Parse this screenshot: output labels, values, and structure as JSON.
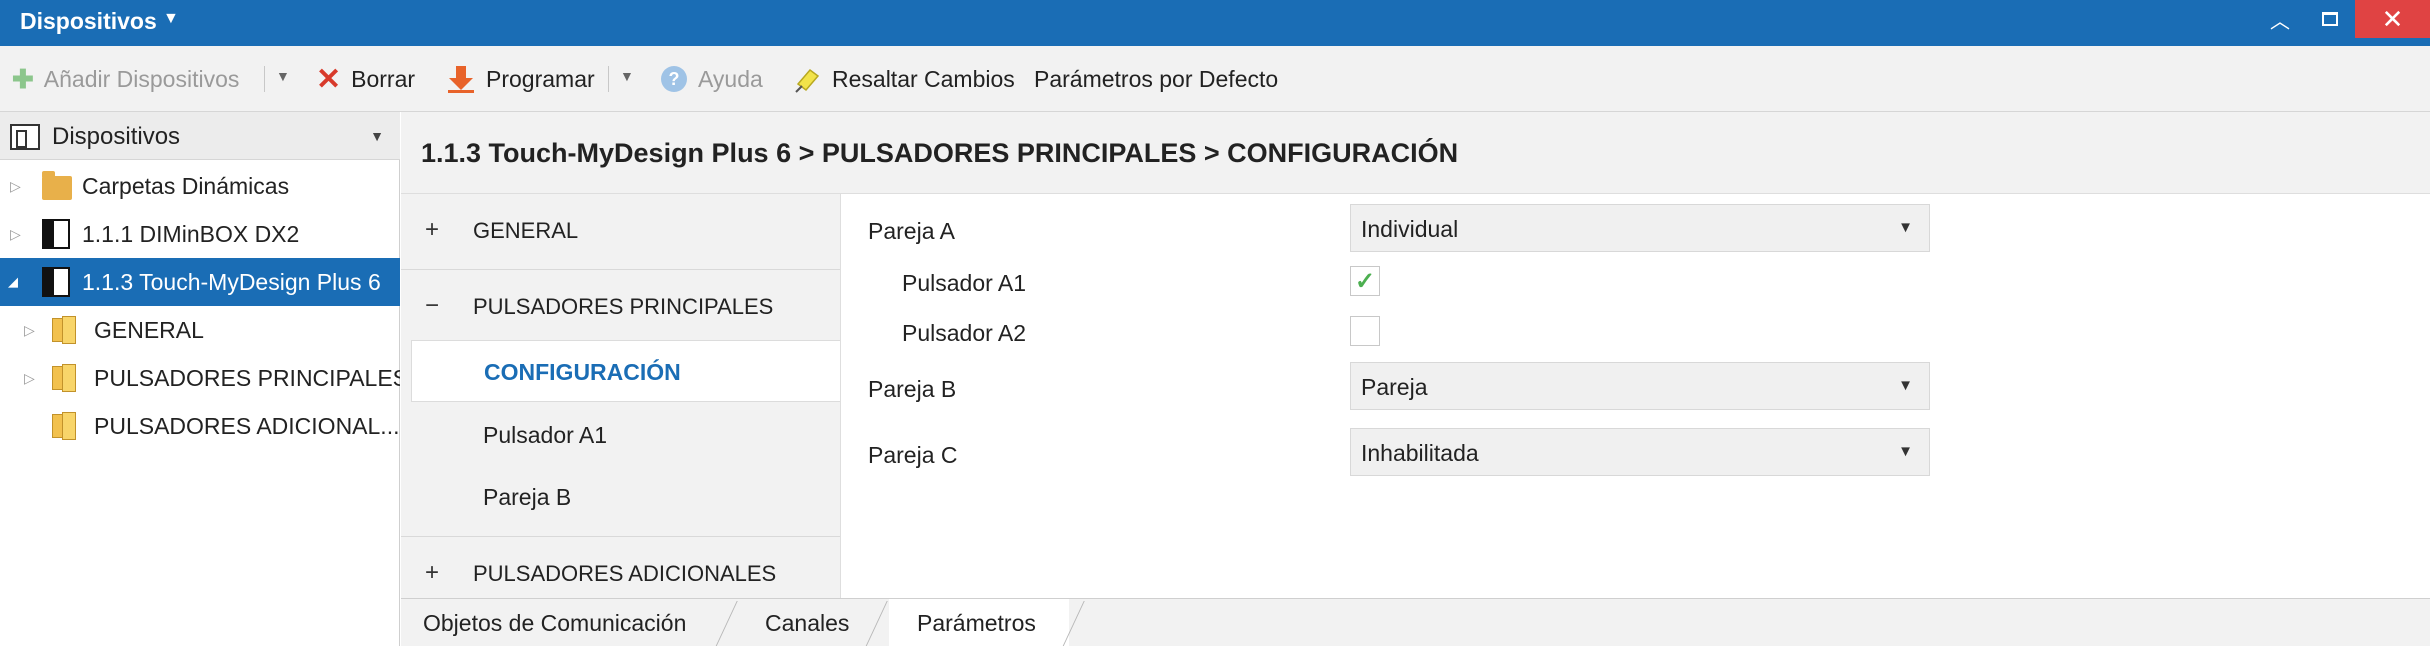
{
  "window": {
    "title": "Dispositivos"
  },
  "toolbar": {
    "add_devices": "Añadir Dispositivos",
    "delete": "Borrar",
    "program": "Programar",
    "help": "Ayuda",
    "highlight_changes": "Resaltar Cambios",
    "default_params": "Parámetros por Defecto"
  },
  "devices_panel": {
    "header": "Dispositivos",
    "tree": [
      {
        "label": "Carpetas Dinámicas",
        "icon": "folder-icon"
      },
      {
        "label": "1.1.1 DIMinBOX DX2",
        "icon": "device-icon"
      },
      {
        "label": "1.1.3 Touch-MyDesign Plus 6",
        "icon": "device-icon",
        "selected": true
      },
      {
        "label": "GENERAL",
        "icon": "parameter-folder-icon"
      },
      {
        "label": "PULSADORES PRINCIPALES",
        "icon": "parameter-folder-icon"
      },
      {
        "label": "PULSADORES ADICIONAL...",
        "icon": "parameter-folder-icon"
      }
    ]
  },
  "breadcrumb": "1.1.3 Touch-MyDesign Plus 6 > PULSADORES PRINCIPALES > CONFIGURACIÓN",
  "param_nav": {
    "groups": [
      {
        "sign": "+",
        "label": "GENERAL"
      },
      {
        "sign": "−",
        "label": "PULSADORES PRINCIPALES"
      },
      {
        "sign": "+",
        "label": "PULSADORES ADICIONALES"
      }
    ],
    "items": [
      {
        "label": "CONFIGURACIÓN",
        "active": true
      },
      {
        "label": "Pulsador A1"
      },
      {
        "label": "Pareja B"
      }
    ]
  },
  "params": {
    "pareja_a": {
      "label": "Pareja A",
      "value": "Individual"
    },
    "pulsador_a1": {
      "label": "Pulsador A1",
      "checked": true,
      "mark": "✓"
    },
    "pulsador_a2": {
      "label": "Pulsador A2",
      "checked": false
    },
    "pareja_b": {
      "label": "Pareja B",
      "value": "Pareja"
    },
    "pareja_c": {
      "label": "Pareja C",
      "value": "Inhabilitada"
    }
  },
  "tabs": [
    {
      "label": "Objetos de Comunicación"
    },
    {
      "label": "Canales"
    },
    {
      "label": "Parámetros",
      "active": true
    }
  ],
  "colors": {
    "accent": "#1a6db5",
    "close": "#e04343",
    "check": "#4caf50"
  }
}
